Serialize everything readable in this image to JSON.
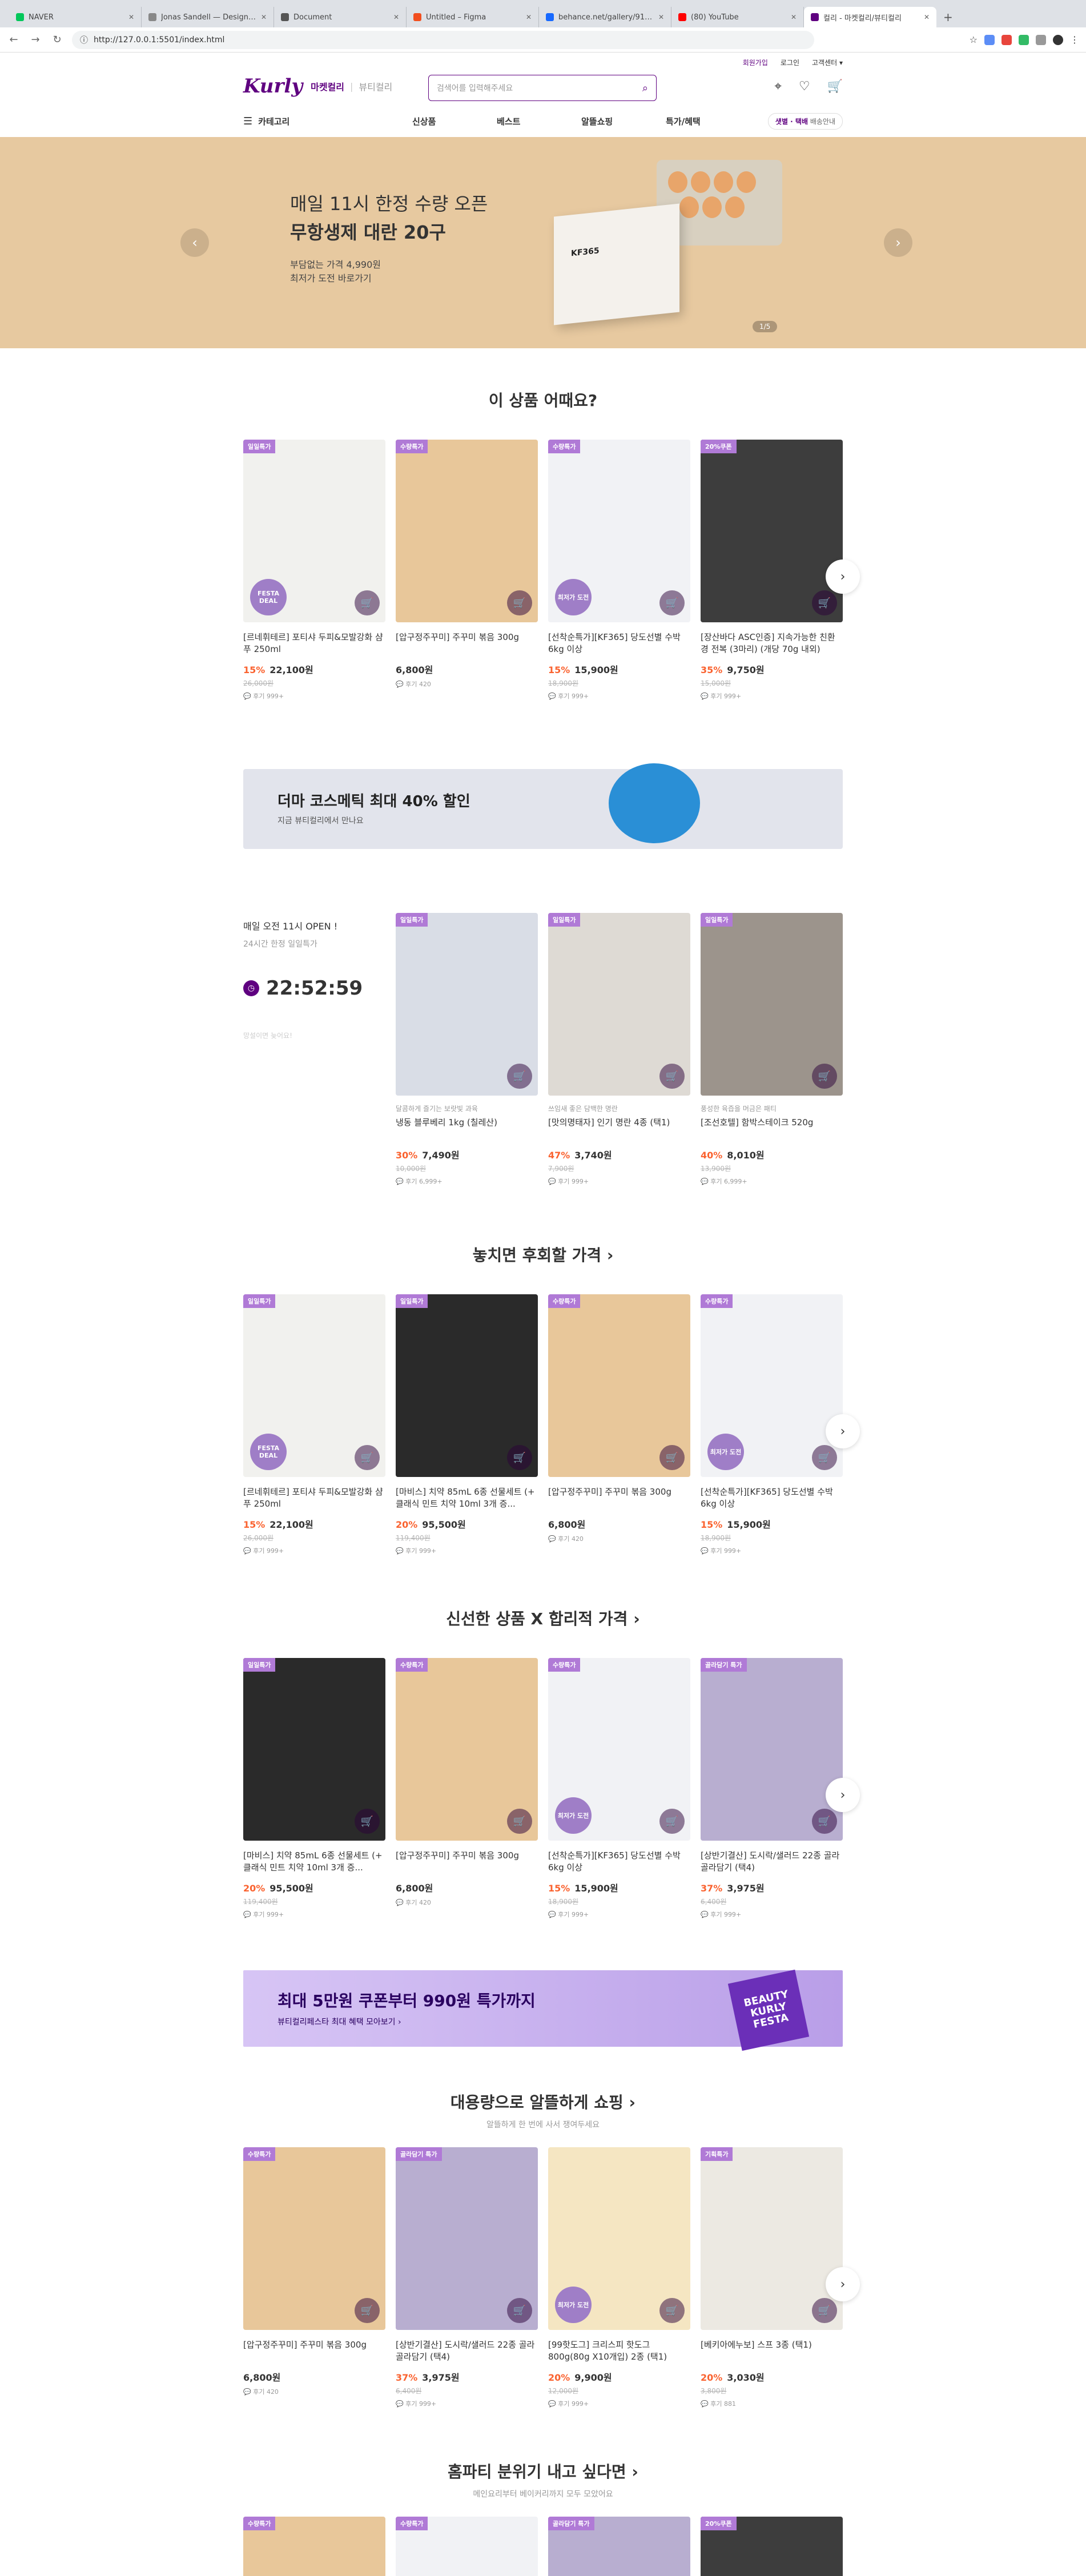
{
  "browser": {
    "tabs": [
      {
        "title": "NAVER",
        "color": "#03c75a"
      },
      {
        "title": "Jonas Sandell — Designer & ...",
        "color": "#888888"
      },
      {
        "title": "Document",
        "color": "#555555"
      },
      {
        "title": "Untitled – Figma",
        "color": "#f24e1e"
      },
      {
        "title": "behance.net/gallery/9162099...",
        "color": "#1769ff"
      },
      {
        "title": "(80) YouTube",
        "color": "#ff0000"
      },
      {
        "title": "컬리 - 마켓컬리/뷰티컬리",
        "color": "#5f0080"
      }
    ],
    "url": "http://127.0.0.1:5501/index.html"
  },
  "header": {
    "top_links": [
      "회원가입",
      "로그인",
      "고객센터 ▾"
    ],
    "logo": "Kurly",
    "market": "마켓컬리",
    "beauty": "뷰티컬리",
    "search_placeholder": "검색어를 입력해주세요",
    "category": "카테고리",
    "menus": [
      "신상품",
      "베스트",
      "알뜰쇼핑",
      "특가/혜택"
    ],
    "delivery_highlight": "샛별 · 택배",
    "delivery_rest": "배송안내"
  },
  "hero": {
    "line1": "매일 11시 한정 수량 오픈",
    "line2": "무항생제 대란 20구",
    "line3": "부담없는 가격 4,990원",
    "line4": "최저가 도전 바로가기",
    "box_label": "KF365",
    "page": "1/5"
  },
  "sections": [
    {
      "title": "이 상품 어때요?",
      "subtitle": "",
      "products": [
        {
          "badge": "일일특가",
          "bg": "#f1f1ee",
          "sticker": "FESTA DEAL",
          "name": "[르네휘테르] 포티샤 두피&모발강화 샴푸 250ml",
          "discount": "15%",
          "price": "22,100원",
          "orig": "26,000원",
          "reviews": "후기 999+"
        },
        {
          "badge": "수량특가",
          "bg": "#e8c79a",
          "sticker": "",
          "name": "[압구정주꾸미] 주꾸미 볶음 300g",
          "discount": "",
          "price": "6,800원",
          "orig": "",
          "reviews": "후기 420"
        },
        {
          "badge": "수량특가",
          "bg": "#f1f2f5",
          "sticker": "최저가 도전",
          "name": "[선착순특가][KF365] 당도선별 수박 6kg 이상",
          "discount": "15%",
          "price": "15,900원",
          "orig": "18,900원",
          "reviews": "후기 999+"
        },
        {
          "badge": "20%쿠폰",
          "bg": "#3d3d3d",
          "sticker": "",
          "name": "[장산바다 ASC인증] 지속가능한 친환경 전복 (3마리) (개당 70g 내외)",
          "discount": "35%",
          "price": "9,750원",
          "orig": "15,000원",
          "reviews": "후기 999+"
        }
      ]
    }
  ],
  "cosmetic_banner": {
    "title": "더마 코스메틱 최대 40% 할인",
    "sub": "지금 뷰티컬리에서 만나요"
  },
  "deal": {
    "line1": "매일 오전 11시 OPEN !",
    "line2": "24시간 한정 일일특가",
    "timer": "22:52:59",
    "note": "망설이면 늦어요!",
    "products": [
      {
        "badge": "일일특가",
        "bg": "#d9dde6",
        "desc": "달콤하게 즐기는 보랏빛 과육",
        "name": "냉동 블루베리 1kg (칠레산)",
        "discount": "30%",
        "price": "7,490원",
        "orig": "10,000원",
        "reviews": "후기 6,999+"
      },
      {
        "badge": "일일특가",
        "bg": "#dedad4",
        "desc": "쓰임새 좋은 담백한 명란",
        "name": "[맛의명태자] 인기 명란 4종 (택1)",
        "discount": "47%",
        "price": "3,740원",
        "orig": "7,900원",
        "reviews": "후기 999+"
      },
      {
        "badge": "일일특가",
        "bg": "#9c948c",
        "desc": "풍성한 육즙을 머금은 패티",
        "name": "[조선호텔] 함박스테이크 520g",
        "discount": "40%",
        "price": "8,010원",
        "orig": "13,900원",
        "reviews": "후기 6,999+"
      }
    ]
  },
  "sections2": [
    {
      "title": "놓치면 후회할 가격 ›",
      "subtitle": "",
      "products": [
        {
          "badge": "일일특가",
          "bg": "#f1f1ee",
          "sticker": "FESTA DEAL",
          "name": "[르네휘테르] 포티샤 두피&모발강화 샴푸 250ml",
          "discount": "15%",
          "price": "22,100원",
          "orig": "26,000원",
          "reviews": "후기 999+"
        },
        {
          "badge": "일일특가",
          "bg": "#2a2a2a",
          "sticker": "",
          "name": "[마비스] 치약 85mL 6종 선물세트 (+ 클래식 민트 치약 10ml 3개 증...",
          "discount": "20%",
          "price": "95,500원",
          "orig": "119,400원",
          "reviews": "후기 999+"
        },
        {
          "badge": "수량특가",
          "bg": "#e8c79a",
          "sticker": "",
          "name": "[압구정주꾸미] 주꾸미 볶음 300g",
          "discount": "",
          "price": "6,800원",
          "orig": "",
          "reviews": "후기 420"
        },
        {
          "badge": "수량특가",
          "bg": "#f1f2f5",
          "sticker": "최저가 도전",
          "name": "[선착순특가][KF365] 당도선별 수박 6kg 이상",
          "discount": "15%",
          "price": "15,900원",
          "orig": "18,900원",
          "reviews": "후기 999+"
        }
      ]
    },
    {
      "title": "신선한 상품 X 합리적 가격 ›",
      "subtitle": "",
      "products": [
        {
          "badge": "일일특가",
          "bg": "#2a2a2a",
          "sticker": "",
          "name": "[마비스] 치약 85mL 6종 선물세트 (+ 클래식 민트 치약 10ml 3개 증...",
          "discount": "20%",
          "price": "95,500원",
          "orig": "119,400원",
          "reviews": "후기 999+"
        },
        {
          "badge": "수량특가",
          "bg": "#e8c79a",
          "sticker": "",
          "name": "[압구정주꾸미] 주꾸미 볶음 300g",
          "discount": "",
          "price": "6,800원",
          "orig": "",
          "reviews": "후기 420"
        },
        {
          "badge": "수량특가",
          "bg": "#f1f2f5",
          "sticker": "최저가 도전",
          "name": "[선착순특가][KF365] 당도선별 수박 6kg 이상",
          "discount": "15%",
          "price": "15,900원",
          "orig": "18,900원",
          "reviews": "후기 999+"
        },
        {
          "badge": "골라담기 특가",
          "bg": "#b8aed0",
          "sticker": "",
          "name": "[상반기결산] 도시락/샐러드 22종 골라 골라담기 (택4)",
          "discount": "37%",
          "price": "3,975원",
          "orig": "6,400원",
          "reviews": "후기 999+"
        }
      ]
    }
  ],
  "purple_banner": {
    "title": "최대 5만원 쿠폰부터 990원 특가까지",
    "sub": "뷰티컬리페스타 최대 혜택 모아보기 ›",
    "seal": "BEAUTY KURLY FESTA"
  },
  "sections3": [
    {
      "title": "대용량으로 알뜰하게 쇼핑 ›",
      "subtitle": "알뜰하게 한 번에 사서 쟁여두세요",
      "products": [
        {
          "badge": "수량특가",
          "bg": "#e8c79a",
          "sticker": "",
          "name": "[압구정주꾸미] 주꾸미 볶음 300g",
          "discount": "",
          "price": "6,800원",
          "orig": "",
          "reviews": "후기 420"
        },
        {
          "badge": "골라담기 특가",
          "bg": "#b8aed0",
          "sticker": "",
          "name": "[상반기결산] 도시락/샐러드 22종 골라 골라담기 (택4)",
          "discount": "37%",
          "price": "3,975원",
          "orig": "6,400원",
          "reviews": "후기 999+"
        },
        {
          "badge": "",
          "bg": "#f5e6c2",
          "sticker": "최저가 도전",
          "name": "[99핫도그] 크리스피 핫도그 800g(80g X10개입) 2종 (택1)",
          "discount": "20%",
          "price": "9,900원",
          "orig": "12,000원",
          "reviews": "후기 999+"
        },
        {
          "badge": "기획특가",
          "bg": "#ece9e2",
          "sticker": "",
          "name": "[베키아에누보] 스프 3종 (택1)",
          "discount": "20%",
          "price": "3,030원",
          "orig": "3,800원",
          "reviews": "후기 881"
        }
      ]
    },
    {
      "title": "홈파티 분위기 내고 싶다면 ›",
      "subtitle": "메인요리부터 베이커리까지 모두 모았어요",
      "products": [
        {
          "badge": "수량특가",
          "bg": "#e8c79a",
          "sticker": "",
          "name": "",
          "discount": "",
          "price": "",
          "orig": "",
          "reviews": ""
        },
        {
          "badge": "수량특가",
          "bg": "#f1f2f5",
          "sticker": "",
          "name": "",
          "discount": "",
          "price": "",
          "orig": "",
          "reviews": ""
        },
        {
          "badge": "골라담기 특가",
          "bg": "#b8aed0",
          "sticker": "",
          "name": "",
          "discount": "",
          "price": "",
          "orig": "",
          "reviews": ""
        },
        {
          "badge": "20%쿠폰",
          "bg": "#3d3d3d",
          "sticker": "",
          "name": "",
          "discount": "",
          "price": "",
          "orig": "",
          "reviews": ""
        }
      ]
    }
  ]
}
